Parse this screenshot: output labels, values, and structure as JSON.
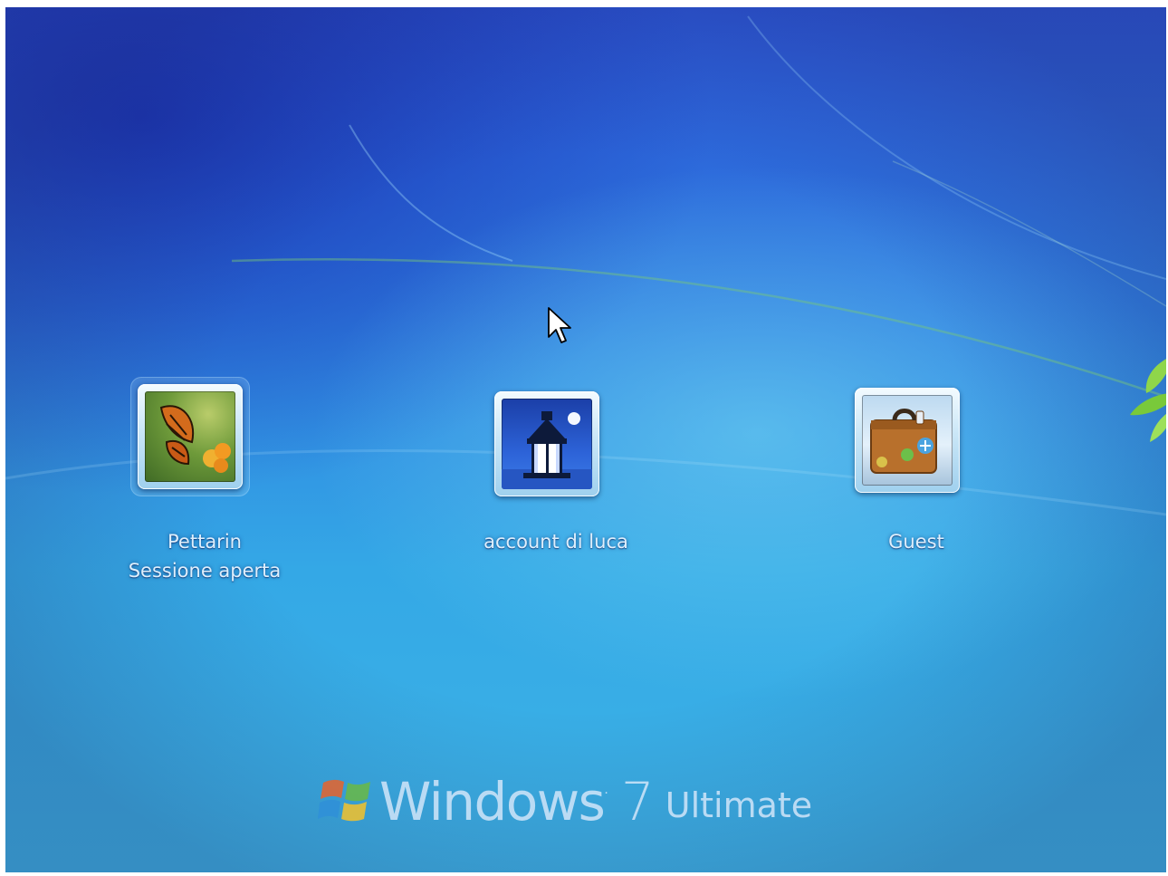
{
  "accounts": [
    {
      "name": "Pettarin",
      "status": "Sessione aperta",
      "picture": "butterfly-picture",
      "selected": true
    },
    {
      "name": "account di luca",
      "status": "",
      "picture": "lighthouse-picture",
      "selected": false
    },
    {
      "name": "Guest",
      "status": "",
      "picture": "suitcase-picture",
      "selected": false
    }
  ],
  "branding": {
    "logo": "windows-flag-logo",
    "product": "Windows",
    "version": "7",
    "edition": "Ultimate"
  },
  "colors": {
    "background_top": "#2b56d6",
    "background_bottom": "#3db4e6",
    "label_text": "#dfeffc"
  },
  "cursor": "arrow-pointer-icon"
}
